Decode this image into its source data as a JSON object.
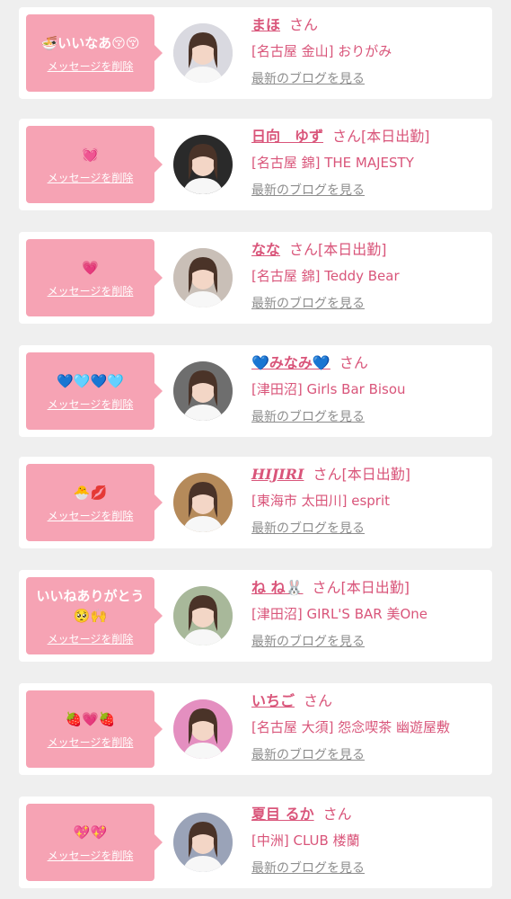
{
  "delete_label": "メッセージを削除",
  "blog_label": "最新のブログを見る",
  "honorific": "さん",
  "colors": {
    "accent": "#d9557a",
    "bubble": "#f6a3b4",
    "background": "#efefef"
  },
  "items": [
    {
      "message": "🍜いいなあ😚😚",
      "name": "まほ",
      "badge": "",
      "shop": "[名古屋 金山] おりがみ",
      "avatar_icon": "girl-avatar-icon"
    },
    {
      "message": "💓",
      "name": "日向　ゆず",
      "badge": "[本日出勤]",
      "shop": "[名古屋 錦] THE MAJESTY",
      "avatar_icon": "girl-avatar-icon"
    },
    {
      "message": "💗",
      "name": "なな",
      "badge": "[本日出勤]",
      "shop": "[名古屋 錦] Teddy Bear",
      "avatar_icon": "girl-avatar-icon"
    },
    {
      "message": "💙🩵💙🩵",
      "name": "💙みなみ💙",
      "badge": "",
      "shop": "[津田沼] Girls Bar Bisou",
      "avatar_icon": "girl-avatar-icon"
    },
    {
      "message": "🐣💋",
      "name": "HIJIRI",
      "badge": "[本日出勤]",
      "shop": "[東海市 太田川] esprit",
      "avatar_icon": "girl-avatar-icon"
    },
    {
      "message": "いいねありがとう🥺🙌",
      "name": "ね ね🐰",
      "badge": "[本日出勤]",
      "shop": "[津田沼] GIRL'S BAR 美One",
      "avatar_icon": "girl-avatar-icon"
    },
    {
      "message": "🍓💗🍓",
      "name": "いちご",
      "badge": "",
      "shop": "[名古屋 大須] 怨念喫茶 幽遊屋敷",
      "avatar_icon": "girl-avatar-icon"
    },
    {
      "message": "💖💖",
      "name": "夏目 るか",
      "badge": "",
      "shop": "[中洲] CLUB 楼蘭",
      "avatar_icon": "girl-avatar-icon"
    }
  ]
}
